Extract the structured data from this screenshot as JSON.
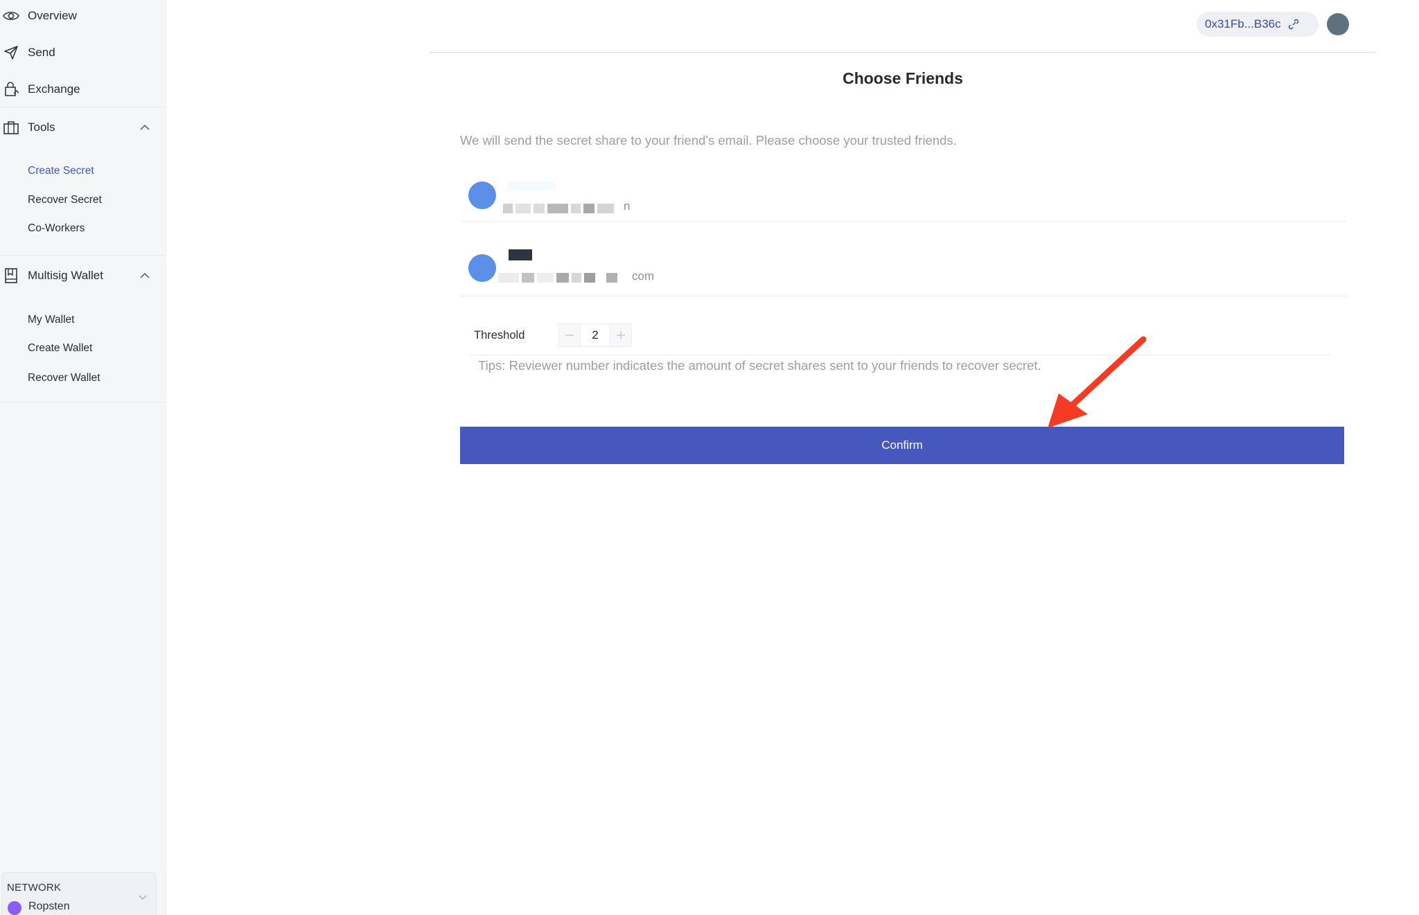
{
  "sidebar": {
    "items": [
      {
        "label": "Overview",
        "icon": "eye-icon"
      },
      {
        "label": "Send",
        "icon": "send-icon"
      },
      {
        "label": "Exchange",
        "icon": "exchange-icon"
      },
      {
        "label": "Tools",
        "icon": "tools-icon",
        "expanded": true,
        "children": [
          "Create Secret",
          "Recover Secret",
          "Co-Workers"
        ]
      },
      {
        "label": "Multisig Wallet",
        "icon": "wallet-icon",
        "expanded": true,
        "children": [
          "My Wallet",
          "Create Wallet",
          "Recover Wallet"
        ]
      }
    ],
    "active_child": "Create Secret",
    "network": {
      "label": "NETWORK",
      "value": "Ropsten",
      "color": "#8b5cf6"
    }
  },
  "header": {
    "address": "0x31Fb...B36c"
  },
  "main": {
    "title": "Choose Friends",
    "description": "We will send the secret share to your friend's email. Please choose your trusted friends.",
    "friends": [
      {
        "email_tail": "n"
      },
      {
        "email_tail": "com"
      }
    ],
    "threshold": {
      "label": "Threshold",
      "value": "2",
      "tips": "Tips: Reviewer number indicates the amount of secret shares sent to your friends to recover secret."
    },
    "confirm_label": "Confirm"
  },
  "colors": {
    "accent": "#4657be",
    "avatar": "#5b8fe8",
    "annotation_arrow": "#f53b24"
  }
}
